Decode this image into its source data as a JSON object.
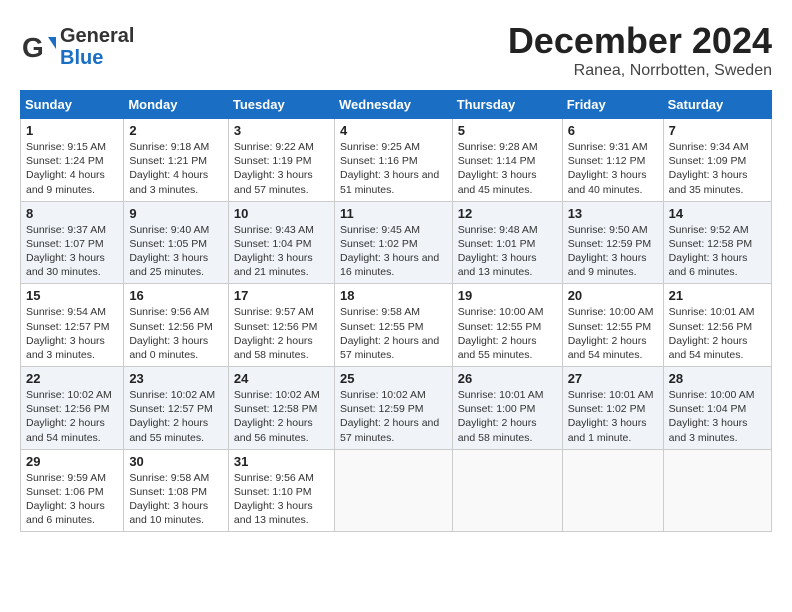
{
  "header": {
    "logo_line1": "General",
    "logo_line2": "Blue",
    "month": "December 2024",
    "location": "Ranea, Norrbotten, Sweden"
  },
  "weekdays": [
    "Sunday",
    "Monday",
    "Tuesday",
    "Wednesday",
    "Thursday",
    "Friday",
    "Saturday"
  ],
  "weeks": [
    [
      {
        "day": "1",
        "rise": "Sunrise: 9:15 AM",
        "set": "Sunset: 1:24 PM",
        "daylight": "Daylight: 4 hours and 9 minutes."
      },
      {
        "day": "2",
        "rise": "Sunrise: 9:18 AM",
        "set": "Sunset: 1:21 PM",
        "daylight": "Daylight: 4 hours and 3 minutes."
      },
      {
        "day": "3",
        "rise": "Sunrise: 9:22 AM",
        "set": "Sunset: 1:19 PM",
        "daylight": "Daylight: 3 hours and 57 minutes."
      },
      {
        "day": "4",
        "rise": "Sunrise: 9:25 AM",
        "set": "Sunset: 1:16 PM",
        "daylight": "Daylight: 3 hours and 51 minutes."
      },
      {
        "day": "5",
        "rise": "Sunrise: 9:28 AM",
        "set": "Sunset: 1:14 PM",
        "daylight": "Daylight: 3 hours and 45 minutes."
      },
      {
        "day": "6",
        "rise": "Sunrise: 9:31 AM",
        "set": "Sunset: 1:12 PM",
        "daylight": "Daylight: 3 hours and 40 minutes."
      },
      {
        "day": "7",
        "rise": "Sunrise: 9:34 AM",
        "set": "Sunset: 1:09 PM",
        "daylight": "Daylight: 3 hours and 35 minutes."
      }
    ],
    [
      {
        "day": "8",
        "rise": "Sunrise: 9:37 AM",
        "set": "Sunset: 1:07 PM",
        "daylight": "Daylight: 3 hours and 30 minutes."
      },
      {
        "day": "9",
        "rise": "Sunrise: 9:40 AM",
        "set": "Sunset: 1:05 PM",
        "daylight": "Daylight: 3 hours and 25 minutes."
      },
      {
        "day": "10",
        "rise": "Sunrise: 9:43 AM",
        "set": "Sunset: 1:04 PM",
        "daylight": "Daylight: 3 hours and 21 minutes."
      },
      {
        "day": "11",
        "rise": "Sunrise: 9:45 AM",
        "set": "Sunset: 1:02 PM",
        "daylight": "Daylight: 3 hours and 16 minutes."
      },
      {
        "day": "12",
        "rise": "Sunrise: 9:48 AM",
        "set": "Sunset: 1:01 PM",
        "daylight": "Daylight: 3 hours and 13 minutes."
      },
      {
        "day": "13",
        "rise": "Sunrise: 9:50 AM",
        "set": "Sunset: 12:59 PM",
        "daylight": "Daylight: 3 hours and 9 minutes."
      },
      {
        "day": "14",
        "rise": "Sunrise: 9:52 AM",
        "set": "Sunset: 12:58 PM",
        "daylight": "Daylight: 3 hours and 6 minutes."
      }
    ],
    [
      {
        "day": "15",
        "rise": "Sunrise: 9:54 AM",
        "set": "Sunset: 12:57 PM",
        "daylight": "Daylight: 3 hours and 3 minutes."
      },
      {
        "day": "16",
        "rise": "Sunrise: 9:56 AM",
        "set": "Sunset: 12:56 PM",
        "daylight": "Daylight: 3 hours and 0 minutes."
      },
      {
        "day": "17",
        "rise": "Sunrise: 9:57 AM",
        "set": "Sunset: 12:56 PM",
        "daylight": "Daylight: 2 hours and 58 minutes."
      },
      {
        "day": "18",
        "rise": "Sunrise: 9:58 AM",
        "set": "Sunset: 12:55 PM",
        "daylight": "Daylight: 2 hours and 57 minutes."
      },
      {
        "day": "19",
        "rise": "Sunrise: 10:00 AM",
        "set": "Sunset: 12:55 PM",
        "daylight": "Daylight: 2 hours and 55 minutes."
      },
      {
        "day": "20",
        "rise": "Sunrise: 10:00 AM",
        "set": "Sunset: 12:55 PM",
        "daylight": "Daylight: 2 hours and 54 minutes."
      },
      {
        "day": "21",
        "rise": "Sunrise: 10:01 AM",
        "set": "Sunset: 12:56 PM",
        "daylight": "Daylight: 2 hours and 54 minutes."
      }
    ],
    [
      {
        "day": "22",
        "rise": "Sunrise: 10:02 AM",
        "set": "Sunset: 12:56 PM",
        "daylight": "Daylight: 2 hours and 54 minutes."
      },
      {
        "day": "23",
        "rise": "Sunrise: 10:02 AM",
        "set": "Sunset: 12:57 PM",
        "daylight": "Daylight: 2 hours and 55 minutes."
      },
      {
        "day": "24",
        "rise": "Sunrise: 10:02 AM",
        "set": "Sunset: 12:58 PM",
        "daylight": "Daylight: 2 hours and 56 minutes."
      },
      {
        "day": "25",
        "rise": "Sunrise: 10:02 AM",
        "set": "Sunset: 12:59 PM",
        "daylight": "Daylight: 2 hours and 57 minutes."
      },
      {
        "day": "26",
        "rise": "Sunrise: 10:01 AM",
        "set": "Sunset: 1:00 PM",
        "daylight": "Daylight: 2 hours and 58 minutes."
      },
      {
        "day": "27",
        "rise": "Sunrise: 10:01 AM",
        "set": "Sunset: 1:02 PM",
        "daylight": "Daylight: 3 hours and 1 minute."
      },
      {
        "day": "28",
        "rise": "Sunrise: 10:00 AM",
        "set": "Sunset: 1:04 PM",
        "daylight": "Daylight: 3 hours and 3 minutes."
      }
    ],
    [
      {
        "day": "29",
        "rise": "Sunrise: 9:59 AM",
        "set": "Sunset: 1:06 PM",
        "daylight": "Daylight: 3 hours and 6 minutes."
      },
      {
        "day": "30",
        "rise": "Sunrise: 9:58 AM",
        "set": "Sunset: 1:08 PM",
        "daylight": "Daylight: 3 hours and 10 minutes."
      },
      {
        "day": "31",
        "rise": "Sunrise: 9:56 AM",
        "set": "Sunset: 1:10 PM",
        "daylight": "Daylight: 3 hours and 13 minutes."
      },
      null,
      null,
      null,
      null
    ]
  ]
}
